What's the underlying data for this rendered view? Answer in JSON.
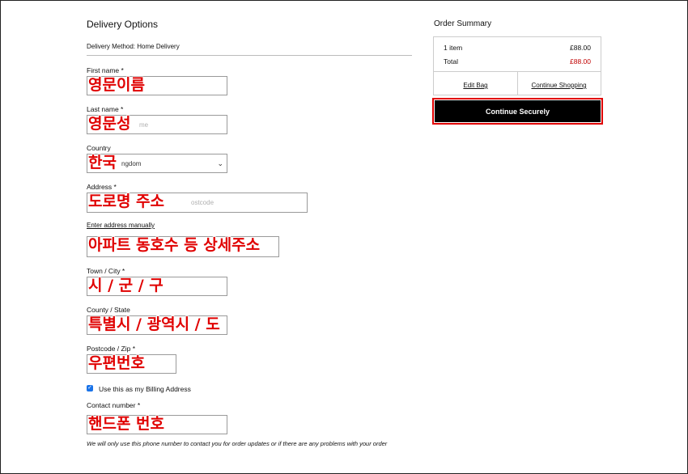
{
  "delivery": {
    "title": "Delivery Options",
    "method_label": "Delivery Method:",
    "method_value": "Home Delivery"
  },
  "form": {
    "first_name": {
      "label": "First name *",
      "annotation": "영문이름",
      "placeholder": ""
    },
    "last_name": {
      "label": "Last name *",
      "annotation": "영문성",
      "placeholder": "me"
    },
    "country": {
      "label": "Country",
      "annotation": "한국",
      "value": "ngdom"
    },
    "address": {
      "label": "Address *",
      "annotation": "도로명 주소",
      "placeholder": "ostcode"
    },
    "enter_manually": "Enter address manually",
    "address2": {
      "annotation": "아파트 동호수 등 상세주소"
    },
    "town": {
      "label": "Town / City *",
      "annotation": "시 / 군 / 구"
    },
    "county": {
      "label": "County / State",
      "annotation": "특별시 / 광역시 / 도"
    },
    "postcode": {
      "label": "Postcode / Zip *",
      "annotation": "우편번호"
    },
    "billing": {
      "label": "Use this as my Billing Address",
      "checked": true
    },
    "contact": {
      "label": "Contact number *",
      "annotation": "핸드폰 번호"
    },
    "phone_note": "We will only use this phone number to contact you for order updates or if there are any problems with your order"
  },
  "summary": {
    "title": "Order Summary",
    "items_label": "1 item",
    "items_price": "£88.00",
    "total_label": "Total",
    "total_price": "£88.00",
    "edit_bag": "Edit Bag",
    "continue_shopping": "Continue Shopping",
    "cta": "Continue Securely"
  },
  "colors": {
    "annotation": "#e00000",
    "cta_background": "#000000",
    "cta_outline": "#e00000",
    "total_price": "#c00000",
    "checkbox": "#1a73e8"
  },
  "icons": {
    "select_arrow": "chevron-down-icon",
    "checkbox": "checkmark-icon"
  }
}
